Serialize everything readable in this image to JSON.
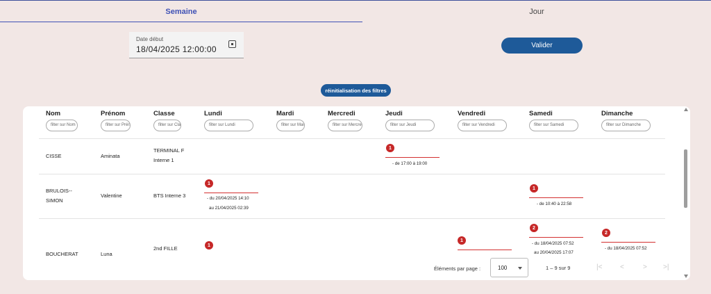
{
  "tabs": [
    {
      "label": "Semaine",
      "active": true
    },
    {
      "label": "Jour",
      "active": false
    }
  ],
  "date_field": {
    "label": "Date début",
    "value": "18/04/2025 12:00:00",
    "icon": "calendar-icon"
  },
  "valider_label": "Valider",
  "reset_label": "réinitialisation des filtres",
  "table": {
    "columns": [
      {
        "header": "Nom",
        "filter_placeholder": "filter sur Nom"
      },
      {
        "header": "Prénom",
        "filter_placeholder": "filter sur Prénom"
      },
      {
        "header": "Classe",
        "filter_placeholder": "filter sur Classe"
      },
      {
        "header": "Lundi",
        "filter_placeholder": "filter sur Lundi"
      },
      {
        "header": "Mardi",
        "filter_placeholder": "filter sur Mardi"
      },
      {
        "header": "Mercredi",
        "filter_placeholder": "filter sur Mercredi"
      },
      {
        "header": "Jeudi",
        "filter_placeholder": "filter sur Jeudi"
      },
      {
        "header": "Vendredi",
        "filter_placeholder": "filter sur Vendredi"
      },
      {
        "header": "Samedi",
        "filter_placeholder": "filter sur Samedi"
      },
      {
        "header": "Dimanche",
        "filter_placeholder": "filter sur Dimanche"
      }
    ],
    "rows": [
      {
        "nom": "CISSE",
        "prenom": "Aminata",
        "classe": [
          "TERMINAL F",
          "Interne 1"
        ],
        "jeudi": {
          "count": "1",
          "lines": [
            "- de 17:00 à 19:00"
          ]
        }
      },
      {
        "nom": [
          "BRULOIS--",
          "SIMON"
        ],
        "prenom": "Valentine",
        "classe": [
          "BTS Interne 3"
        ],
        "lundi": {
          "count": "1",
          "lines": [
            "- du 20/04/2025 14:10",
            "au 21/04/2025 02:39"
          ]
        },
        "samedi": {
          "count": "1",
          "lines": [
            "- de 10:40 à 22:58"
          ]
        }
      },
      {
        "nom": "BOUCHERAT",
        "prenom": "Luna",
        "classe": [
          "2nd FILLE"
        ],
        "lundi": {
          "count": "1"
        },
        "vendredi": {
          "count": "1"
        },
        "samedi": {
          "count": "2",
          "lines": [
            "- du 18/04/2025 07:52",
            "au 20/04/2025 17:07"
          ]
        },
        "dimanche": {
          "count": "2",
          "lines": [
            "- du 18/04/2025 07:52"
          ]
        }
      }
    ]
  },
  "paginator": {
    "items_per_page_label": "Éléments par page :",
    "page_size": "100",
    "range": "1 – 9 sur 9"
  }
}
